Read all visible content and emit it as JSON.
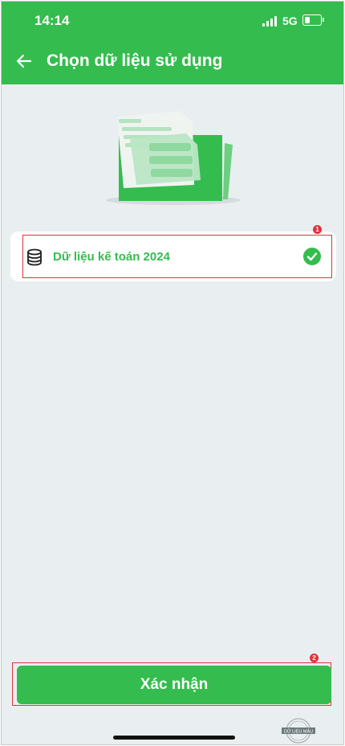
{
  "status_bar": {
    "time": "14:14",
    "network": "5G"
  },
  "header": {
    "back_icon": "arrow-left-icon",
    "title": "Chọn dữ liệu sử dụng"
  },
  "data_list": {
    "items": [
      {
        "icon": "database-icon",
        "label": "Dữ liệu kế toán 2024",
        "selected": true
      }
    ]
  },
  "annotations": {
    "marker_1": "1",
    "marker_2": "2"
  },
  "footer": {
    "confirm_label": "Xác nhận"
  },
  "watermark": {
    "text": "DỮ LIỆU MẪU"
  },
  "colors": {
    "brand_green": "#34bd4e",
    "background": "#e9eff0",
    "annotation_red": "#e0333c"
  }
}
